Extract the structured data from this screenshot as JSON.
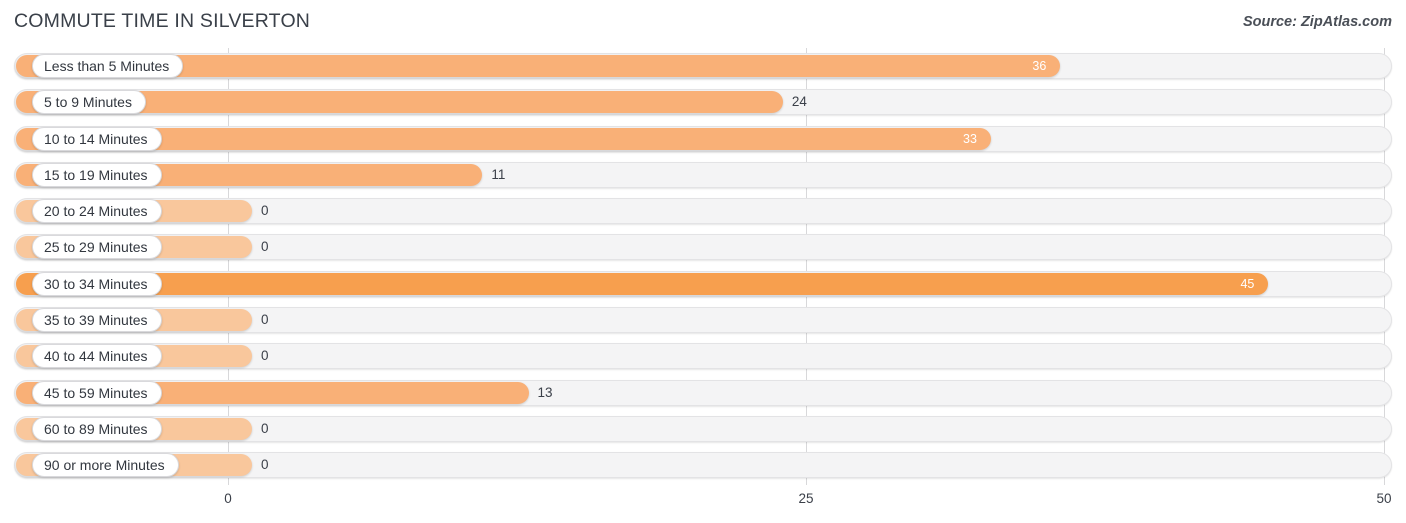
{
  "header": {
    "title": "COMMUTE TIME IN SILVERTON",
    "source": "Source: ZipAtlas.com"
  },
  "colors": {
    "bar_light": "#f9b077",
    "bar_strong": "#f79f4e",
    "bar_zero": "#f9c79c",
    "track": "#f4f4f5",
    "track_border": "#e3e3e5",
    "gridline": "#d8d8da",
    "title_text": "#3a4049",
    "label_text": "#32373f",
    "value_in_text": "#ffffff",
    "value_out_text": "#3b4049"
  },
  "chart_data": {
    "type": "bar",
    "orientation": "horizontal",
    "title": "COMMUTE TIME IN SILVERTON",
    "xlabel": "",
    "ylabel": "",
    "xlim": [
      0,
      50
    ],
    "grid": true,
    "legend": null,
    "xticks": [
      "0",
      "25",
      "50"
    ],
    "xtick_values": [
      0,
      25,
      50
    ],
    "categories": [
      "Less than 5 Minutes",
      "5 to 9 Minutes",
      "10 to 14 Minutes",
      "15 to 19 Minutes",
      "20 to 24 Minutes",
      "25 to 29 Minutes",
      "30 to 34 Minutes",
      "35 to 39 Minutes",
      "40 to 44 Minutes",
      "45 to 59 Minutes",
      "60 to 89 Minutes",
      "90 or more Minutes"
    ],
    "values": [
      36,
      24,
      33,
      11,
      0,
      0,
      45,
      0,
      0,
      13,
      0,
      0
    ],
    "value_labels": [
      "36",
      "24",
      "33",
      "11",
      "0",
      "0",
      "45",
      "0",
      "0",
      "13",
      "0",
      "0"
    ]
  },
  "rows": [
    {
      "label": "Less than 5 Minutes",
      "value": 36,
      "value_label": "36",
      "label_inside": true,
      "style": "light"
    },
    {
      "label": "5 to 9 Minutes",
      "value": 24,
      "value_label": "24",
      "label_inside": false,
      "style": "light"
    },
    {
      "label": "10 to 14 Minutes",
      "value": 33,
      "value_label": "33",
      "label_inside": true,
      "style": "light"
    },
    {
      "label": "15 to 19 Minutes",
      "value": 11,
      "value_label": "11",
      "label_inside": false,
      "style": "light"
    },
    {
      "label": "20 to 24 Minutes",
      "value": 0,
      "value_label": "0",
      "label_inside": false,
      "style": "zero"
    },
    {
      "label": "25 to 29 Minutes",
      "value": 0,
      "value_label": "0",
      "label_inside": false,
      "style": "zero"
    },
    {
      "label": "30 to 34 Minutes",
      "value": 45,
      "value_label": "45",
      "label_inside": true,
      "style": "strong"
    },
    {
      "label": "35 to 39 Minutes",
      "value": 0,
      "value_label": "0",
      "label_inside": false,
      "style": "zero"
    },
    {
      "label": "40 to 44 Minutes",
      "value": 0,
      "value_label": "0",
      "label_inside": false,
      "style": "zero"
    },
    {
      "label": "45 to 59 Minutes",
      "value": 13,
      "value_label": "13",
      "label_inside": false,
      "style": "light"
    },
    {
      "label": "60 to 89 Minutes",
      "value": 0,
      "value_label": "0",
      "label_inside": false,
      "style": "zero"
    },
    {
      "label": "90 or more Minutes",
      "value": 0,
      "value_label": "0",
      "label_inside": false,
      "style": "zero"
    }
  ],
  "axis": {
    "ticks": [
      "0",
      "25",
      "50"
    ]
  }
}
